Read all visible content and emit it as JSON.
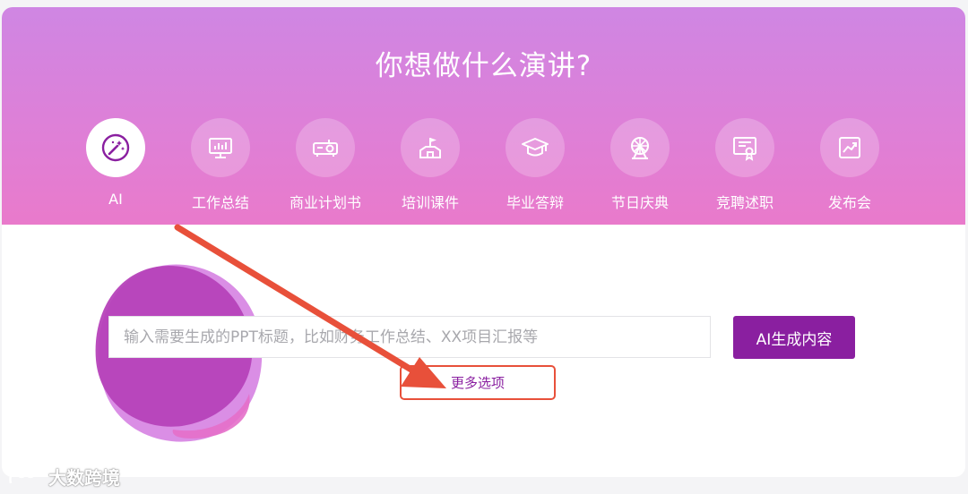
{
  "hero": {
    "title": "你想做什么演讲?"
  },
  "categories": [
    {
      "label": "AI",
      "icon": "magic-wand-icon",
      "active": true
    },
    {
      "label": "工作总结",
      "icon": "monitor-chart-icon",
      "active": false
    },
    {
      "label": "商业计划书",
      "icon": "projector-icon",
      "active": false
    },
    {
      "label": "培训课件",
      "icon": "flag-building-icon",
      "active": false
    },
    {
      "label": "毕业答辩",
      "icon": "graduation-cap-icon",
      "active": false
    },
    {
      "label": "节日庆典",
      "icon": "ferris-wheel-icon",
      "active": false
    },
    {
      "label": "竞聘述职",
      "icon": "certificate-icon",
      "active": false
    },
    {
      "label": "发布会",
      "icon": "trend-chart-icon",
      "active": false
    }
  ],
  "prompt": {
    "placeholder": "输入需要生成的PPT标题，比如财务工作总结、XX项目汇报等",
    "value": ""
  },
  "generate_button": {
    "label": "AI生成内容"
  },
  "more_options": {
    "label": "更多选项"
  },
  "watermark": {
    "text": "大数跨境"
  },
  "colors": {
    "hero_top": "#cf86e3",
    "hero_bottom": "#e97acb",
    "primary": "#8a1fa0",
    "annotation_red": "#e8503a",
    "blob_dark": "#b642b9",
    "blob_light": "#d37ae0"
  }
}
